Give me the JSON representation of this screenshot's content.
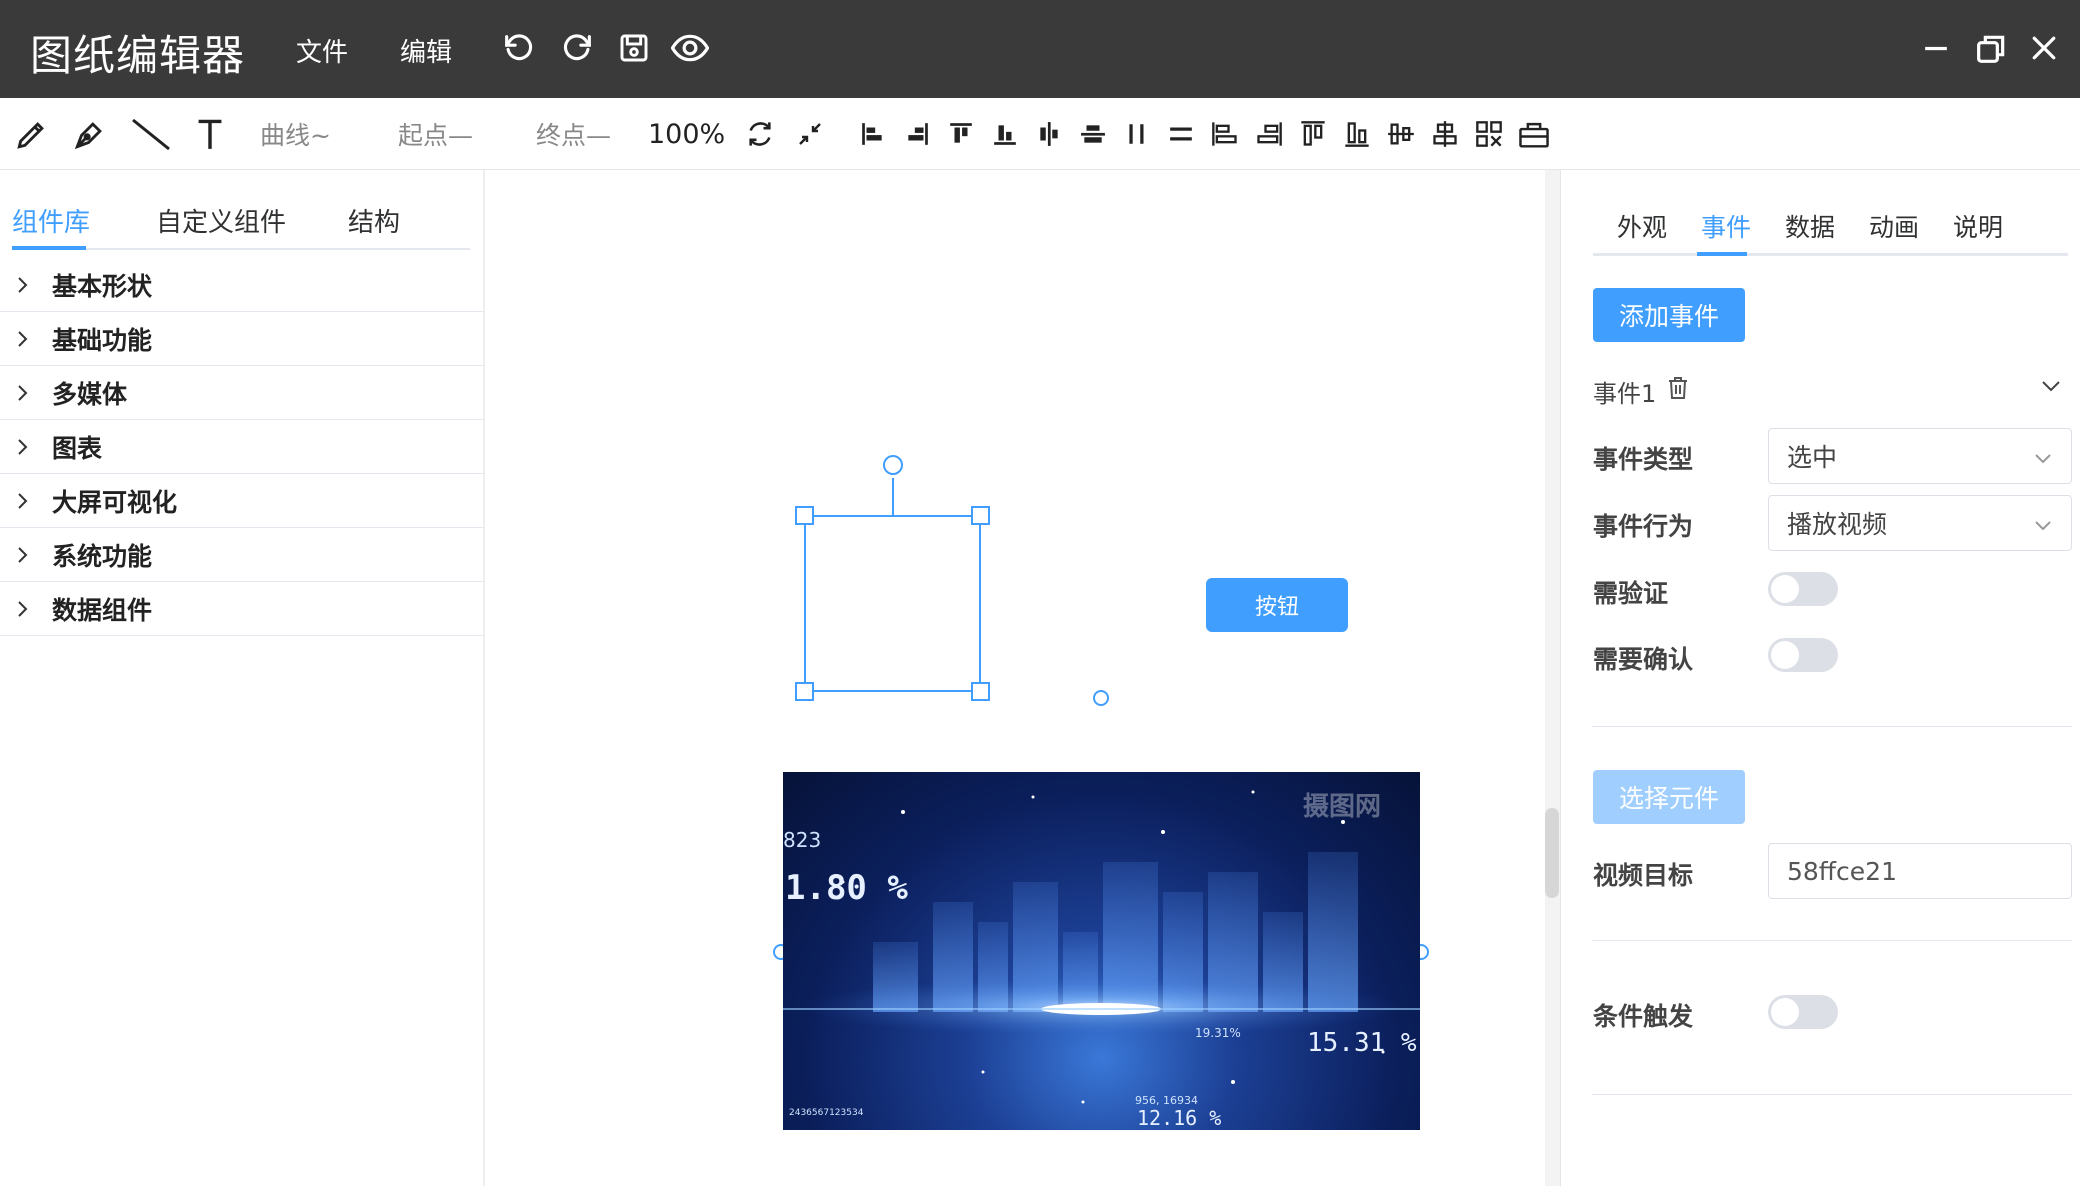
{
  "window": {
    "title": "图纸编辑器",
    "menus": [
      "文件",
      "编辑"
    ]
  },
  "toolbar": {
    "curve_label": "曲线~",
    "start_label": "起点—",
    "end_label": "终点—",
    "zoom": "100%"
  },
  "left_panel": {
    "tabs": [
      "组件库",
      "自定义组件",
      "结构"
    ],
    "active_tab": "组件库",
    "categories": [
      "基本形状",
      "基础功能",
      "多媒体",
      "图表",
      "大屏可视化",
      "系统功能",
      "数据组件"
    ]
  },
  "canvas": {
    "button_label": "按钮",
    "video_overlay": {
      "watermark": "摄图网",
      "stat_top": "823",
      "stat_big": "1.80 %",
      "stat_right": "15.31 %",
      "stat_right_small": "19.31%",
      "stat_bottom": "12.16 %",
      "stat_bottom_small": "956, 16934",
      "stat_bottom_left": "2436567123534"
    }
  },
  "right_panel": {
    "tabs": [
      "外观",
      "事件",
      "数据",
      "动画",
      "说明"
    ],
    "active_tab": "事件",
    "add_event_button": "添加事件",
    "event_name": "事件1",
    "event_type_label": "事件类型",
    "event_type_value": "选中",
    "event_action_label": "事件行为",
    "event_action_value": "播放视频",
    "need_verify_label": "需验证",
    "need_confirm_label": "需要确认",
    "select_element_button": "选择元件",
    "video_target_label": "视频目标",
    "video_target_value": "58ffce21",
    "condition_trigger_label": "条件触发"
  },
  "colors": {
    "accent": "#409eff",
    "titlebar": "#3a3a3a"
  }
}
